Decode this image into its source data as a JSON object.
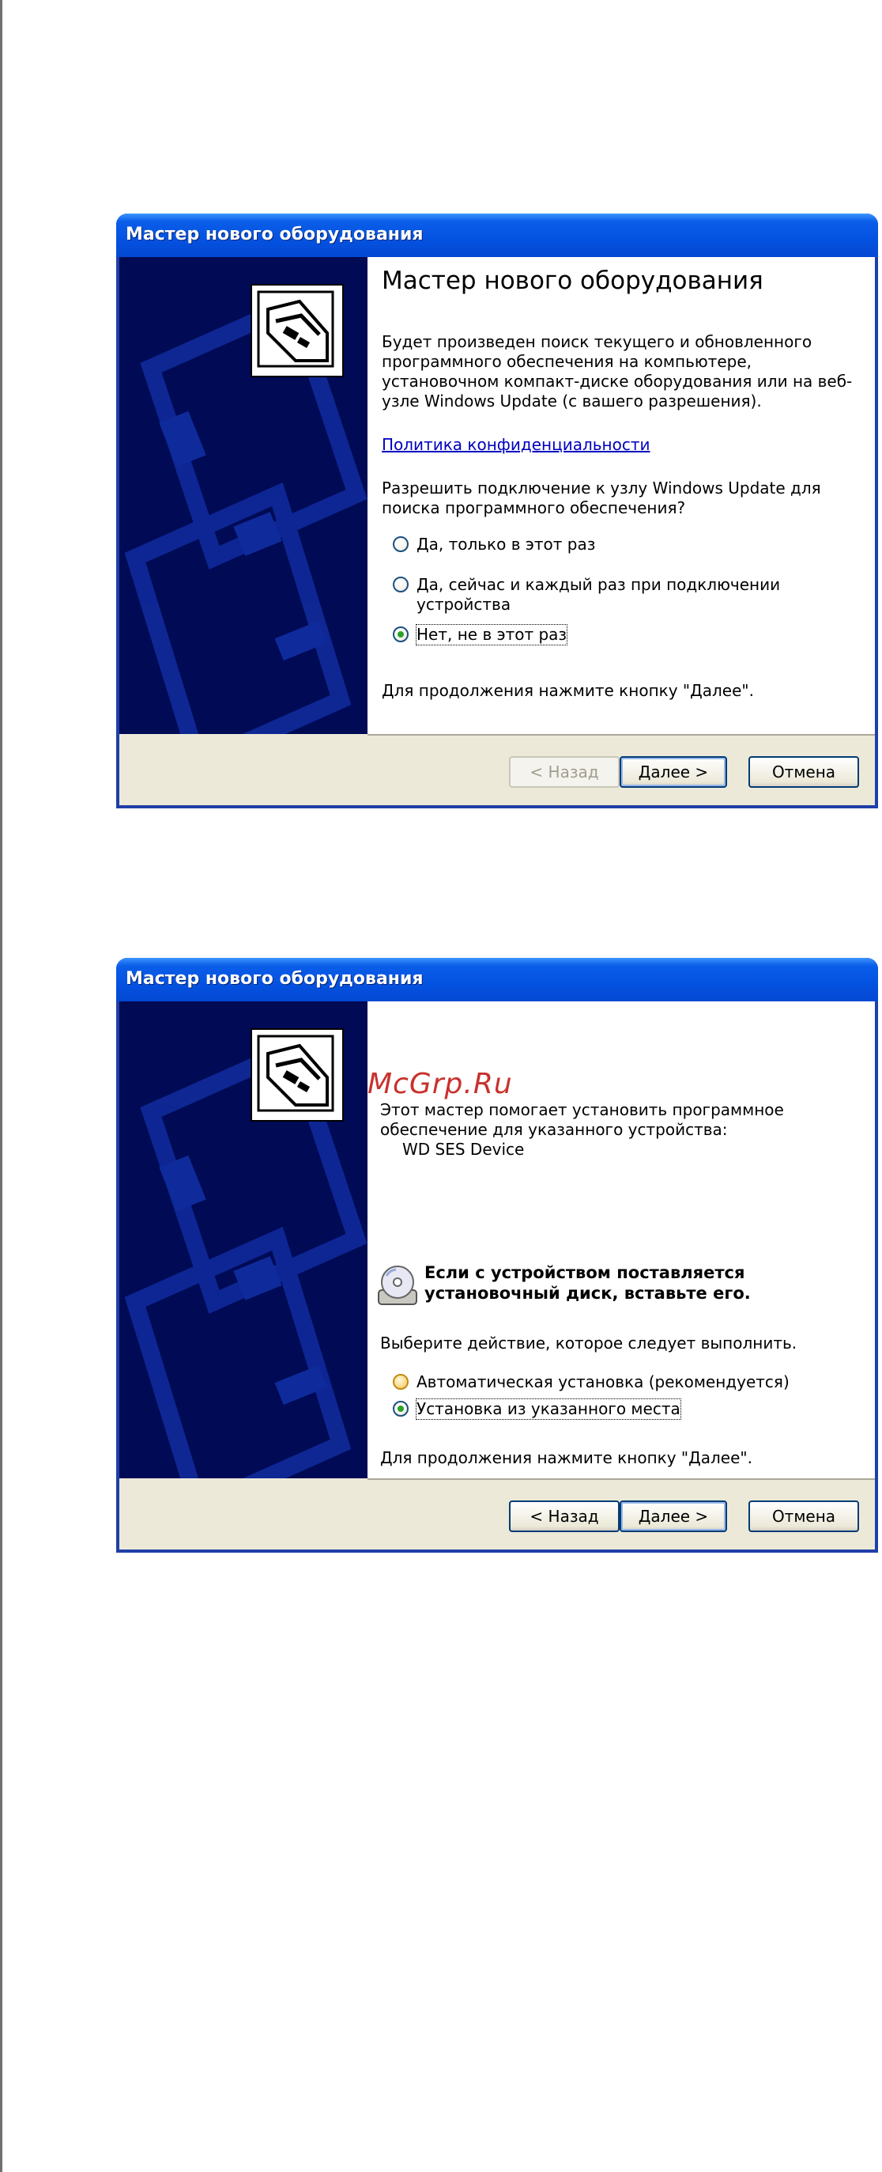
{
  "watermark": "McGrp.Ru",
  "dialog1": {
    "title": "Мастер нового оборудования",
    "heading": "Мастер нового оборудования",
    "intro": "Будет произведен поиск текущего и обновленного программного обеспечения на компьютере, установочном компакт-диске оборудования или на веб-узле Windows Update (с вашего разрешения).",
    "privacy_link": "Политика конфиденциальности",
    "question": "Разрешить подключение к узлу Windows Update для поиска программного обеспечения?",
    "options": [
      {
        "label": "Да, только в этот раз",
        "checked": false
      },
      {
        "label": "Да, сейчас и каждый раз при подключении устройства",
        "checked": false
      },
      {
        "label": "Нет, не в этот раз",
        "checked": true
      }
    ],
    "continue_hint": "Для продолжения нажмите кнопку \"Далее\".",
    "buttons": {
      "back": "< Назад",
      "next": "Далее >",
      "cancel": "Отмена"
    }
  },
  "dialog2": {
    "title": "Мастер нового оборудования",
    "intro": "Этот мастер помогает установить программное обеспечение для указанного устройства:",
    "device": "WD SES Device",
    "cd_message": "Если с устройством поставляется установочный диск, вставьте его.",
    "choose_action": "Выберите действие, которое следует выполнить.",
    "options": [
      {
        "label": "Автоматическая установка (рекомендуется)",
        "checked": false
      },
      {
        "label": "Установка из указанного места",
        "checked": true
      }
    ],
    "continue_hint": "Для продолжения нажмите кнопку \"Далее\".",
    "buttons": {
      "back": "< Назад",
      "next": "Далее >",
      "cancel": "Отмена"
    }
  },
  "colors": {
    "title_bar": "#0552e1",
    "sidebar": "#000a55",
    "dialog_face": "#ece9d8",
    "link": "#0000c0",
    "watermark": "#c8322e"
  },
  "icons": [
    "hardware-board-icon",
    "cd-disc-icon",
    "radio-icon"
  ]
}
